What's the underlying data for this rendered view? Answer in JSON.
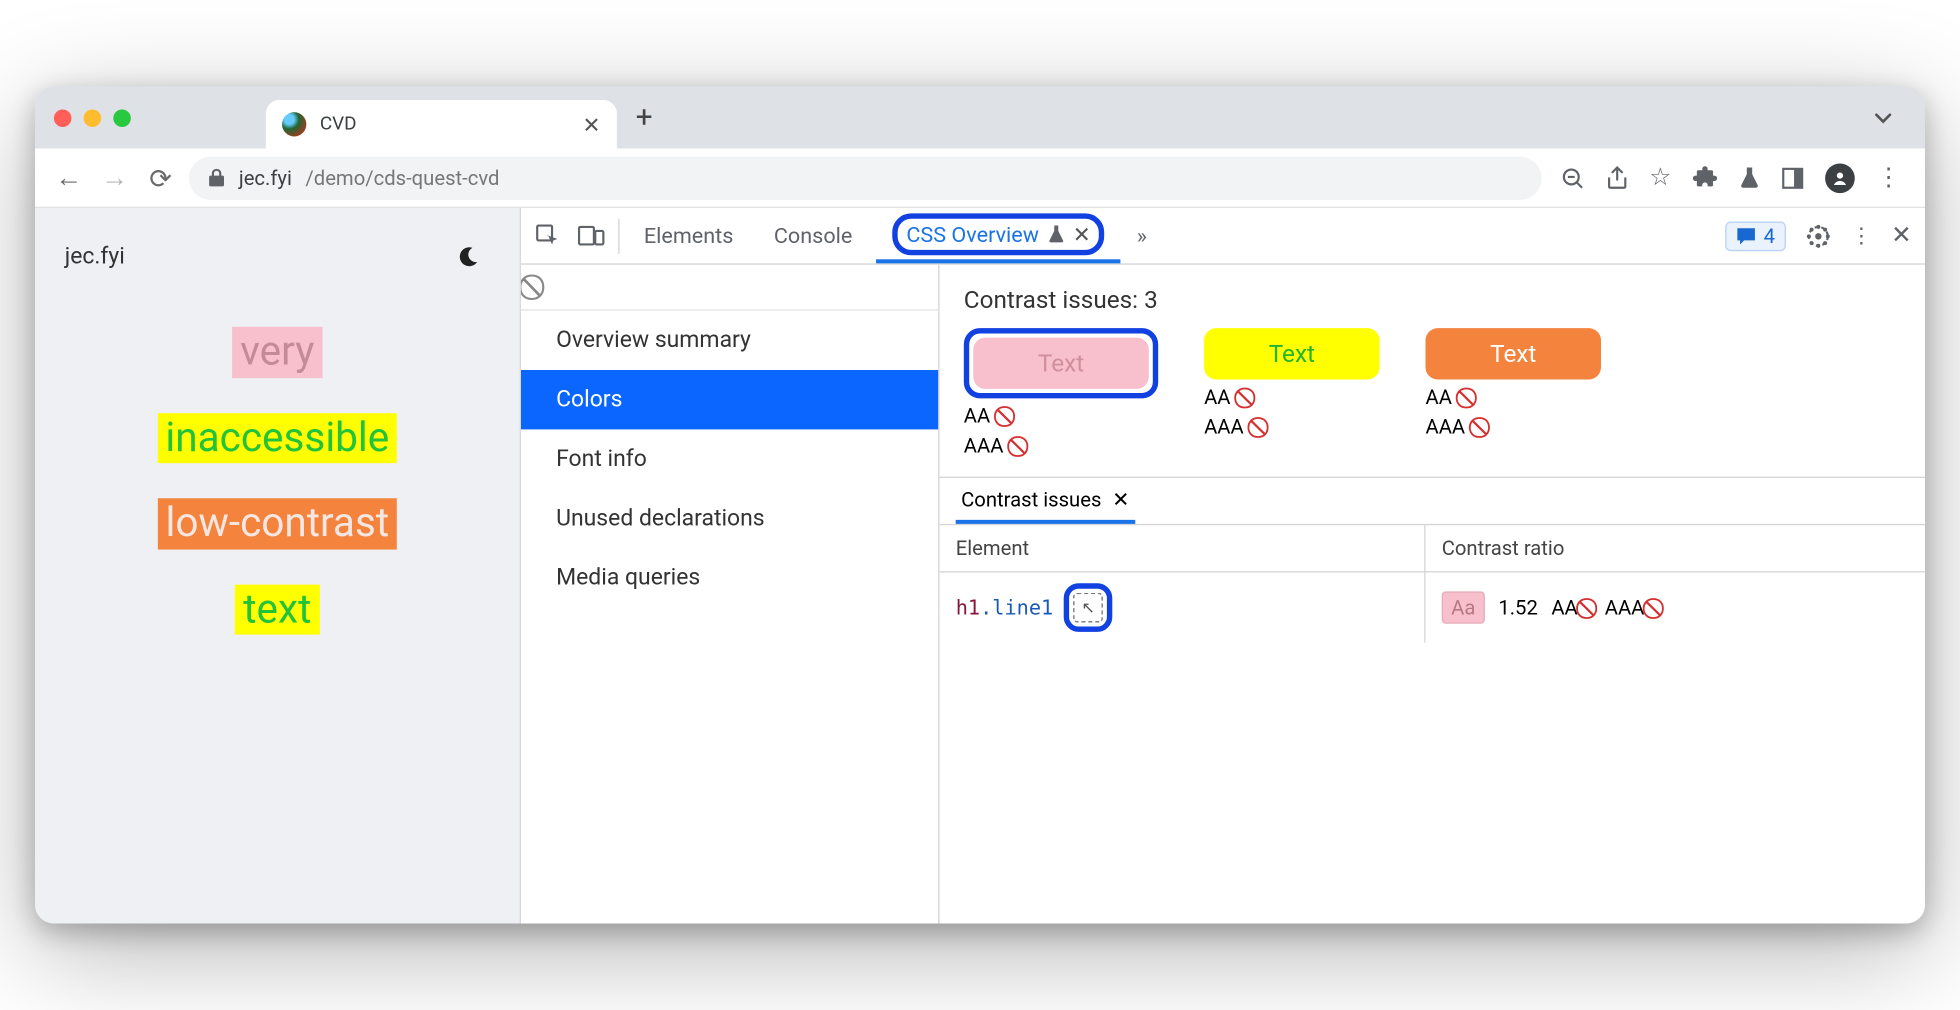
{
  "browser": {
    "tab_title": "CVD",
    "url_display": "jec.fyi/demo/cds-quest-cvd",
    "url_host": "jec.fyi",
    "url_path": "/demo/cds-quest-cvd"
  },
  "page": {
    "site_label": "jec.fyi",
    "words": [
      "very",
      "inaccessible",
      "low-contrast",
      "text"
    ]
  },
  "devtools": {
    "tabs": {
      "elements": "Elements",
      "console": "Console",
      "css_overview": "CSS Overview"
    },
    "messages_count": "4",
    "overview_sections": {
      "summary": "Overview summary",
      "colors": "Colors",
      "font": "Font info",
      "unused": "Unused declarations",
      "media": "Media queries"
    },
    "contrast": {
      "heading": "Contrast issues: 3",
      "swatch_label": "Text",
      "aa": "AA",
      "aaa": "AAA",
      "subtab": "Contrast issues",
      "col_element": "Element",
      "col_ratio": "Contrast ratio",
      "row": {
        "el_tag": "h1",
        "el_class": ".line1",
        "sample": "Aa",
        "ratio": "1.52",
        "aa": "AA",
        "aaa": "AAA"
      }
    }
  }
}
